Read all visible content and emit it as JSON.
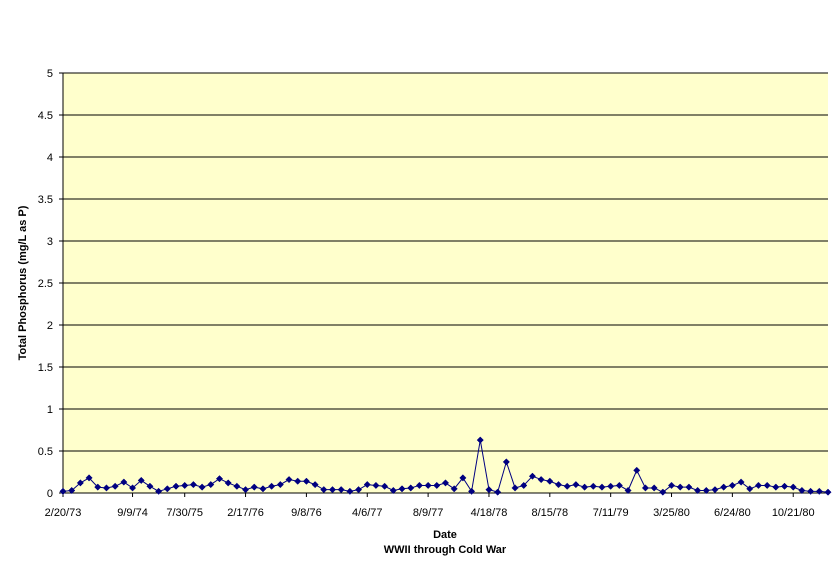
{
  "colors": {
    "plot_background": "#FFFFCC",
    "gridline": "#000000",
    "series": "#000080",
    "axis": "#000000"
  },
  "chart_data": {
    "type": "line",
    "title": "",
    "xlabel": "Date",
    "xlabel_sub": "WWII through Cold War",
    "ylabel": "Total Phosphorus (mg/L as  P)",
    "ylim": [
      0,
      5
    ],
    "yticks": [
      "0",
      "0.5",
      "1",
      "1.5",
      "2",
      "2.5",
      "3",
      "3.5",
      "4",
      "4.5",
      "5"
    ],
    "xtick_labels": [
      "2/20/73",
      "9/9/74",
      "7/30/75",
      "2/17/76",
      "9/8/76",
      "4/6/77",
      "8/9/77",
      "4/18/78",
      "8/15/78",
      "7/11/79",
      "3/25/80",
      "6/24/80",
      "10/21/80"
    ],
    "xtick_label_at_point": [
      0,
      8,
      14,
      21,
      28,
      35,
      42,
      49,
      56,
      63,
      70,
      77,
      84
    ],
    "grid": "horizontal",
    "legend": "none",
    "marker": "diamond",
    "series": [
      {
        "values": [
          0.02,
          0.03,
          0.12,
          0.18,
          0.07,
          0.06,
          0.08,
          0.13,
          0.06,
          0.15,
          0.08,
          0.02,
          0.05,
          0.08,
          0.09,
          0.1,
          0.07,
          0.1,
          0.17,
          0.12,
          0.08,
          0.04,
          0.07,
          0.05,
          0.08,
          0.1,
          0.16,
          0.14,
          0.14,
          0.1,
          0.04,
          0.04,
          0.04,
          0.02,
          0.04,
          0.1,
          0.09,
          0.08,
          0.03,
          0.05,
          0.06,
          0.09,
          0.09,
          0.09,
          0.12,
          0.05,
          0.18,
          0.02,
          0.63,
          0.04,
          0.01,
          0.37,
          0.06,
          0.09,
          0.2,
          0.16,
          0.14,
          0.1,
          0.08,
          0.1,
          0.07,
          0.08,
          0.07,
          0.08,
          0.09,
          0.03,
          0.27,
          0.06,
          0.06,
          0.01,
          0.09,
          0.07,
          0.07,
          0.03,
          0.03,
          0.04,
          0.07,
          0.09,
          0.13,
          0.05,
          0.09,
          0.09,
          0.07,
          0.08,
          0.07,
          0.03,
          0.02,
          0.02,
          0.01
        ]
      }
    ]
  }
}
